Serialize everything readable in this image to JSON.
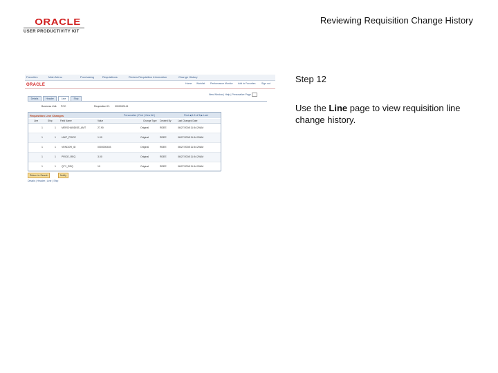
{
  "logo": {
    "brand": "ORACLE",
    "subtitle": "USER PRODUCTIVITY KIT"
  },
  "slide_title": "Reviewing Requisition Change History",
  "step": {
    "label": "Step 12",
    "text_before": "Use the ",
    "text_bold": "Line",
    "text_after": " page to view requisition line change history."
  },
  "screenshot": {
    "nav_items": [
      "Favorites",
      "Main Menu",
      "Purchasing",
      "Requisitions",
      "Review Requisition Information",
      "Change History"
    ],
    "logo": "ORACLE",
    "top_links": [
      "Home",
      "Worklist",
      "Performance Monitor",
      "Add to Favorites",
      "Sign out"
    ],
    "link_bar": "New Window | Help | Personalize Page",
    "tabs": [
      "Details",
      "Header",
      "Line",
      "Ship"
    ],
    "business_unit_label": "Business Unit:",
    "business_unit_value": "PCC",
    "requisition_label": "Requisition ID:",
    "requisition_value": "0000000141",
    "grid_title": "Requisition Line Changes",
    "grid_nav": "Personalize | Find | View All |",
    "grid_nav2": "First ◀ 1-5 of 5 ▶ Last",
    "columns": [
      "Line",
      "Ship",
      "Field Name",
      "Value",
      "Change Type",
      "Created By",
      "Last Changed Date"
    ],
    "rows": [
      {
        "line": "1",
        "ship": "1",
        "field": "MERCHANDISE_AMT",
        "value": "27.90",
        "type": "Original",
        "by": "RDEE",
        "date": "06/27/2008 11:54:29AM"
      },
      {
        "line": "1",
        "ship": "1",
        "field": "UNIT_PRICE",
        "value": "1.00",
        "type": "Original",
        "by": "RDEE",
        "date": "06/27/2008 11:54:29AM"
      },
      {
        "line": "1",
        "ship": "1",
        "field": "VENDOR_ID",
        "value": "0000000403",
        "type": "Original",
        "by": "RDEE",
        "date": "06/27/2008 11:54:29AM"
      },
      {
        "line": "1",
        "ship": "1",
        "field": "PRICE_REQ",
        "value": "3.00",
        "type": "Original",
        "by": "RDEE",
        "date": "06/27/2008 11:54:29AM"
      },
      {
        "line": "1",
        "ship": "1",
        "field": "QTY_REQ",
        "value": "10",
        "type": "Original",
        "by": "RDEE",
        "date": "06/27/2008 11:54:29AM"
      }
    ],
    "buttons": [
      "Return to Search",
      "Notify"
    ],
    "footer_links": "Details | Header | Line | Ship"
  }
}
